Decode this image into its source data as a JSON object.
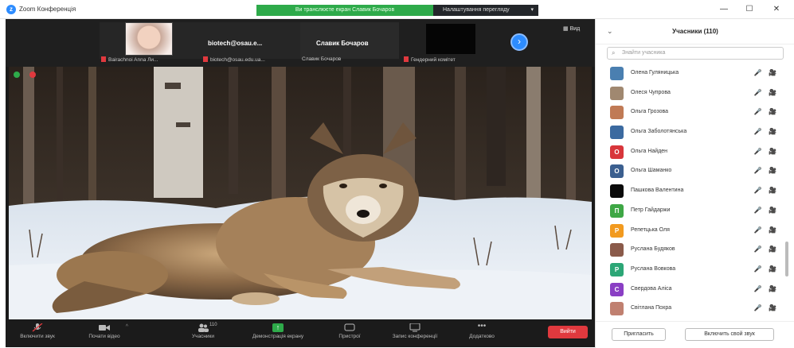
{
  "titlebar": {
    "app_title": "Zoom Конференція",
    "share_banner": "Ви транслюєте екран Славик Бочаров",
    "view_options": "Налаштування перегляду",
    "minimize": "—",
    "maximize": "☐",
    "close": "✕"
  },
  "thumbnails": {
    "name_1": "biotech@osau.e...",
    "name_2": "Славик Бочаров",
    "view_label": "Вид"
  },
  "labels": {
    "l1": "Bairachnoi Anna Ли...",
    "l2": "biotech@osau.edu.ua...",
    "l3": "Славик Бочаров",
    "l4": "Гендерний комітет"
  },
  "toolbar": {
    "audio": "Включити звук",
    "video": "Почати відео",
    "participants": "Учасники",
    "participants_count": "110",
    "share": "Демонстрація екрану",
    "share_icon": "↑",
    "chat": "Пристрої",
    "record": "Запис конференції",
    "more": "Додатково",
    "leave": "Вийти"
  },
  "panel": {
    "title": "Учасники (110)",
    "collapse": "⌄",
    "search_placeholder": "Знайти учасника",
    "participants": [
      {
        "name": "Олена Гуляницька",
        "initial": "",
        "color": "#4a7fb0"
      },
      {
        "name": "Олеся Чупрова",
        "initial": "",
        "color": "#a08870"
      },
      {
        "name": "Ольга Грозова",
        "initial": "",
        "color": "#c07a55"
      },
      {
        "name": "Ольга Заболотянська",
        "initial": "",
        "color": "#3b6aa0"
      },
      {
        "name": "Ольга Найден",
        "initial": "О",
        "color": "#d8363b"
      },
      {
        "name": "Ольга Шаманко",
        "initial": "О",
        "color": "#3b5f8f"
      },
      {
        "name": "Пашкова Валентина",
        "initial": "",
        "color": "#0a0a0a"
      },
      {
        "name": "Петр Гайдаржи",
        "initial": "П",
        "color": "#3ea745"
      },
      {
        "name": "Репетцька Оля",
        "initial": "Р",
        "color": "#f29a1f"
      },
      {
        "name": "Руслана Будяков",
        "initial": "",
        "color": "#8a5a4a"
      },
      {
        "name": "Руслана Вовкова",
        "initial": "Р",
        "color": "#2ca676"
      },
      {
        "name": "Свердова Аліса",
        "initial": "С",
        "color": "#8a3fc4"
      },
      {
        "name": "Світлана Похра",
        "initial": "",
        "color": "#c08070"
      }
    ],
    "invite": "Пригласить",
    "unmute_me": "Включить свой звук",
    "status_icons": "🎤 🎥"
  }
}
